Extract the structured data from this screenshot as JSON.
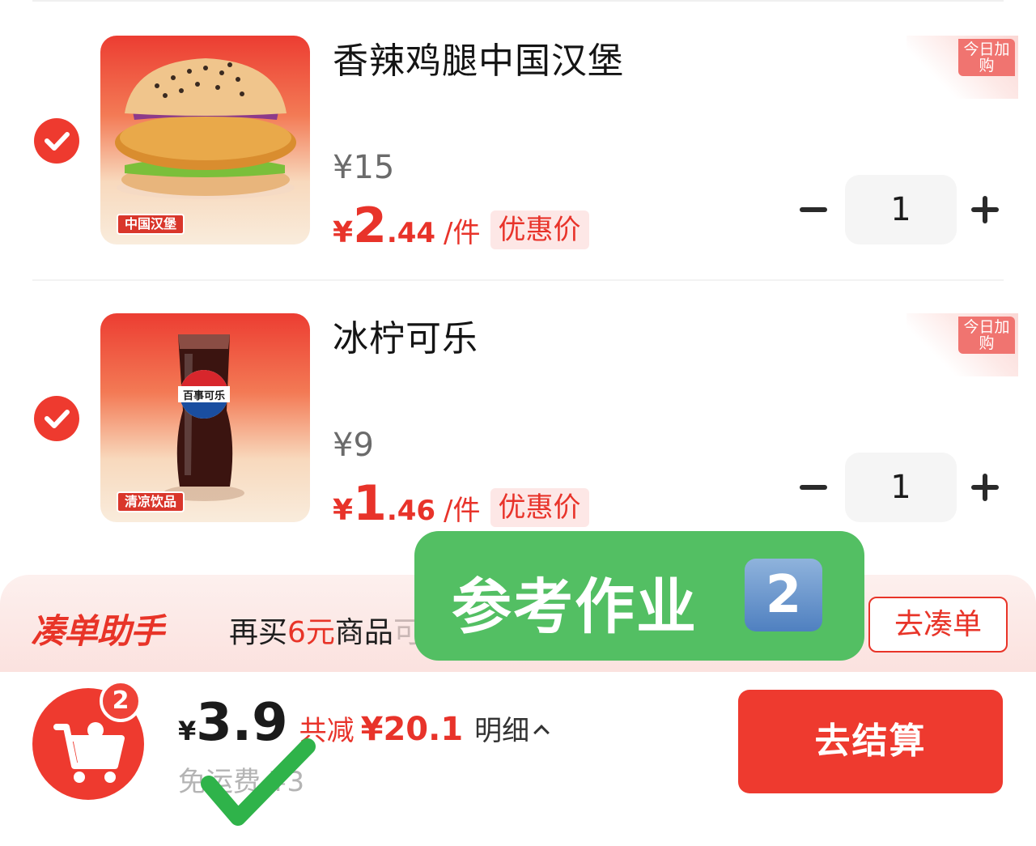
{
  "items": [
    {
      "title": "香辣鸡腿中国汉堡",
      "image_tag": "中国汉堡",
      "orig_price": "¥15",
      "deal": {
        "yen": "¥",
        "int": "2",
        "dec": ".44",
        "unit": "/件",
        "badge": "优惠价"
      },
      "today_tag": "今日加购",
      "quantity": "1",
      "checked": true
    },
    {
      "title": "冰柠可乐",
      "image_tag": "清凉饮品",
      "orig_price": "¥9",
      "deal": {
        "yen": "¥",
        "int": "1",
        "dec": ".46",
        "unit": "/件",
        "badge": "优惠价"
      },
      "today_tag": "今日加购",
      "quantity": "1",
      "checked": true
    }
  ],
  "assistant": {
    "title": "凑单助手",
    "text_prefix": "再买",
    "text_highlight": "6元",
    "text_mid": "商品",
    "text_faded": "可再减3元",
    "button": "去凑单"
  },
  "watermark": {
    "text": "参考作业",
    "num": "2"
  },
  "bottom": {
    "cart_count": "2",
    "yen": "¥",
    "total": "3.9",
    "save_label": "共减",
    "save_amount": "¥20.1",
    "detail": "明细",
    "free_shipping": "免运费 ¥3",
    "checkout": "去结算"
  },
  "colors": {
    "accent": "#ee3a2f",
    "watermark": "#53bf63"
  },
  "icons": {
    "item_check": "check-circle-icon",
    "cart": "shopping-cart-icon",
    "minus": "minus-icon",
    "plus": "plus-icon",
    "overlay_check": "big-green-check-icon"
  }
}
